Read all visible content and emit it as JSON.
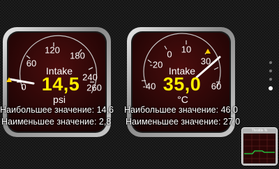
{
  "gauges": [
    {
      "name": "Intake",
      "value": "14,5",
      "unit": "psi",
      "ticks": [
        "0",
        "60",
        "120",
        "180",
        "240",
        "260"
      ],
      "needle_reading": "0",
      "max_label": "Наибольшее значение: 14,6",
      "min_label": "Наименьшее значение: 2,8"
    },
    {
      "name": "Intake",
      "value": "35,0",
      "unit": "°C",
      "ticks": [
        "-40",
        "-20",
        "0",
        "10",
        "30",
        "60"
      ],
      "needle_reading": "35",
      "max_label": "Наибольшее значение: 46,0",
      "min_label": "Наименьшее значение: 27,0"
    }
  ],
  "mini_widget": {
    "title": "Throttle %"
  },
  "page_indicator": {
    "count": 4,
    "active": 3
  },
  "colors": {
    "value": "#ffee00",
    "face": "#2a0606",
    "warning": "#ffcc00"
  },
  "icons": {
    "warning": "warning-triangle-icon"
  }
}
